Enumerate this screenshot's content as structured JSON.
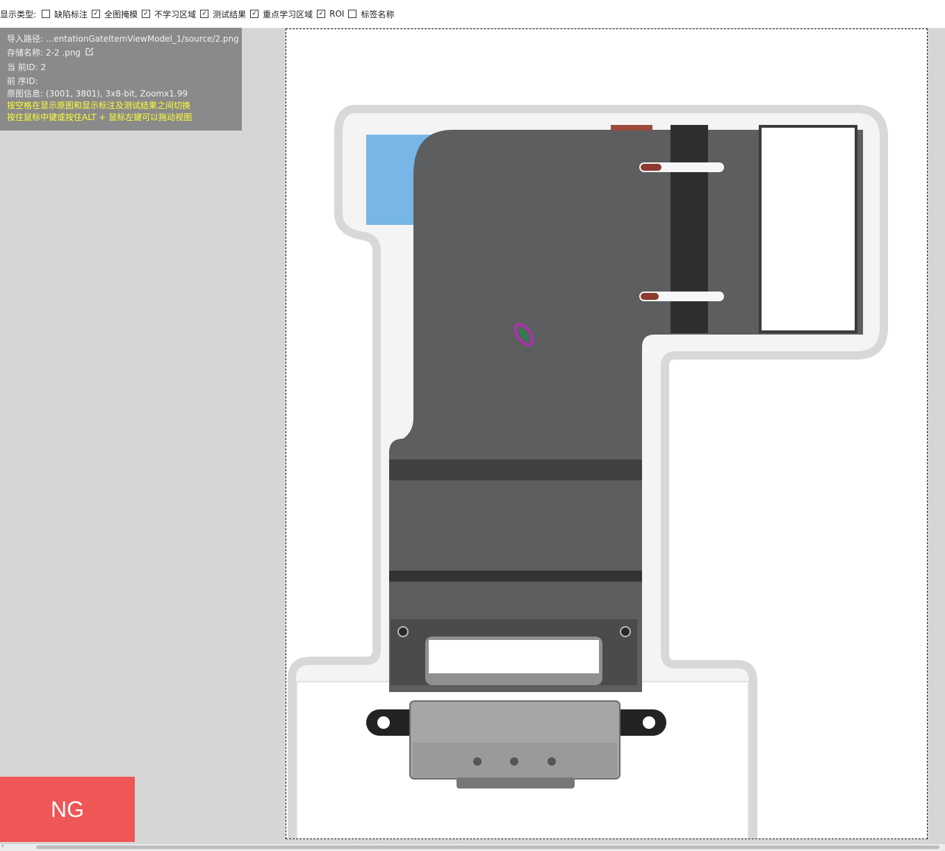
{
  "toolbar": {
    "label": "显示类型:",
    "options": [
      {
        "label": "缺陷标注",
        "checked": false
      },
      {
        "label": "全图掩模",
        "checked": true
      },
      {
        "label": "不学习区域",
        "checked": true
      },
      {
        "label": "测试结果",
        "checked": true
      },
      {
        "label": "重点学习区域",
        "checked": true
      },
      {
        "label": "ROI",
        "checked": true
      },
      {
        "label": "标签名称",
        "checked": false
      }
    ]
  },
  "info": {
    "import_path": "导入路径: ...entationGateItemViewModel_1/source/2.png",
    "storage_name": "存储名称: 2-2 .png",
    "current_id": "当 前ID: 2",
    "prev_id": "前 序ID:",
    "image_info": "原图信息: (3001, 3801), 3x8-bit, Zoomx1.99",
    "hint_space": "按空格在显示原图和显示标注及测试结果之间切换",
    "hint_drag": "按住鼠标中键或按住ALT + 鼠标左键可以拖动视图"
  },
  "result": {
    "label": "NG",
    "color": "#ef5656"
  },
  "icons": {
    "edit": "edit-icon",
    "checkbox": "checkbox-icon",
    "scroll_left": "arrow-left-icon"
  }
}
